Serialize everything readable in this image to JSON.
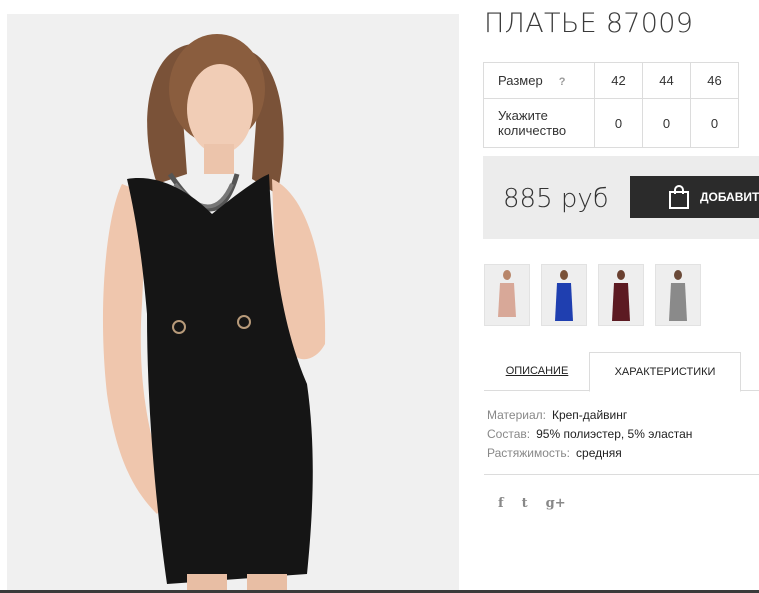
{
  "product": {
    "title": "ПЛАТЬЕ 87009",
    "price": "885 руб",
    "add_to_cart_label": "ДОБАВИТЬ"
  },
  "sizes": {
    "header_label": "Размер",
    "help_mark": "?",
    "quantity_label_line1": "Укажите",
    "quantity_label_line2": "количество",
    "items": [
      {
        "size": "42",
        "qty": "0"
      },
      {
        "size": "44",
        "qty": "0"
      },
      {
        "size": "46",
        "qty": "0"
      }
    ]
  },
  "thumbnails": [
    {
      "name": "thumb-beige-dress",
      "color": "#d8a898"
    },
    {
      "name": "thumb-blue-dress",
      "color": "#1f3fb0"
    },
    {
      "name": "thumb-burgundy-dress",
      "color": "#5c1a22"
    },
    {
      "name": "thumb-grey-dress",
      "color": "#8a8a8a"
    }
  ],
  "tabs": {
    "description": "ОПИСАНИЕ",
    "characteristics": "ХАРАКТЕРИСТИКИ"
  },
  "specs": [
    {
      "key": "Материал:",
      "value": "Креп-дайвинг"
    },
    {
      "key": "Состав:",
      "value": "95% полиэстер, 5% эластан"
    },
    {
      "key": "Растяжимость:",
      "value": "средняя"
    }
  ],
  "social": {
    "facebook": "f",
    "twitter": "t",
    "googleplus": "g+"
  },
  "colors": {
    "dress": "#151515",
    "button_bg": "#2b2b2b",
    "price_bg": "#ececec"
  }
}
